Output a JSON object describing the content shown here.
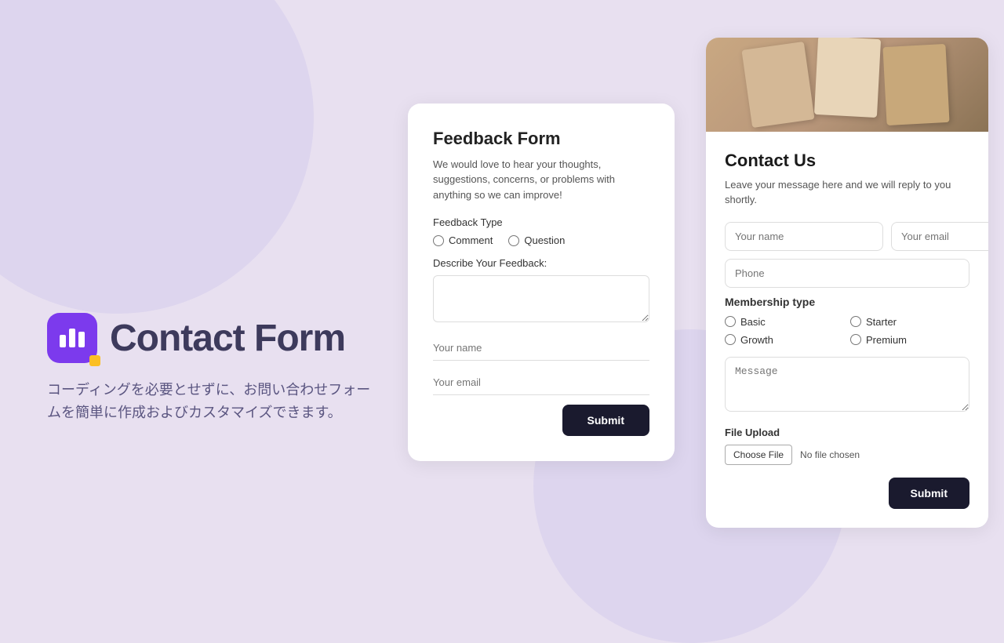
{
  "background": {
    "color": "#e8e0f0"
  },
  "brand": {
    "icon_label": "chart-icon",
    "title": "Contact Form",
    "description": "コーディングを必要とせずに、お問い合わせフォームを簡単に作成およびカスタマイズできます。"
  },
  "feedback_form": {
    "title": "Feedback Form",
    "description": "We would love to hear your thoughts, suggestions, concerns, or problems with anything so we can improve!",
    "feedback_type_label": "Feedback Type",
    "radio_options": [
      {
        "id": "comment",
        "label": "Comment"
      },
      {
        "id": "question",
        "label": "Question"
      }
    ],
    "textarea_label": "Describe Your Feedback:",
    "textarea_placeholder": "",
    "name_placeholder": "Your name",
    "email_placeholder": "Your email",
    "submit_label": "Submit"
  },
  "contact_form": {
    "title": "Contact Us",
    "subtitle": "Leave your message here and we will reply to you shortly.",
    "name_placeholder": "Your name",
    "email_placeholder": "Your email",
    "phone_placeholder": "Phone",
    "membership_label": "Membership type",
    "membership_options": [
      {
        "id": "basic",
        "label": "Basic"
      },
      {
        "id": "starter",
        "label": "Starter"
      },
      {
        "id": "growth",
        "label": "Growth"
      },
      {
        "id": "premium",
        "label": "Premium"
      }
    ],
    "message_placeholder": "Message",
    "file_upload_label": "File Upload",
    "choose_file_label": "Choose File",
    "file_name": "No file chosen",
    "submit_label": "Submit"
  }
}
